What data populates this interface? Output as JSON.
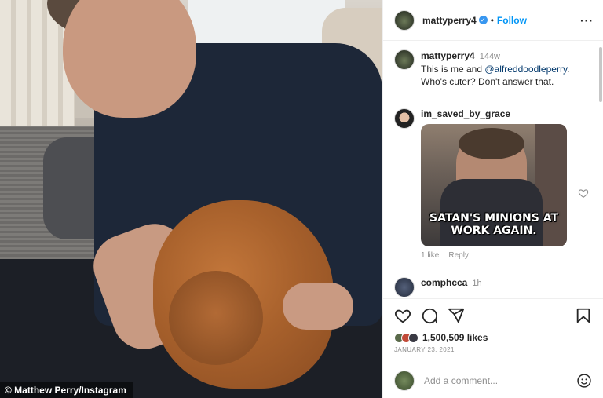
{
  "photo": {
    "credit": "© Matthew Perry/Instagram"
  },
  "post": {
    "username": "mattyperry4",
    "verified_icon": "verified-badge-icon",
    "follow_label": "Follow",
    "more_icon": "more-options-icon",
    "caption": {
      "username": "mattyperry4",
      "time": "144w",
      "text_before": "This is me and ",
      "mention": "@alfreddoodleperry",
      "text_after": ". Who's cuter? Don't answer that."
    },
    "comments": [
      {
        "username": "im_saved_by_grace",
        "gif_text": "SATAN'S MINIONS AT WORK AGAIN.",
        "likes": "1 like",
        "reply_label": "Reply"
      },
      {
        "username": "comphcca",
        "time": "1h"
      }
    ],
    "actions": {
      "icons": [
        "heart-icon",
        "comment-icon",
        "share-icon",
        "bookmark-icon"
      ]
    },
    "likes": "1,500,509 likes",
    "date": "JANUARY 23, 2021",
    "add_comment": {
      "placeholder": "Add a comment...",
      "emoji_icon": "emoji-icon"
    }
  },
  "colors": {
    "accent": "#0095f6",
    "text": "#262626",
    "muted": "#8e8e8e",
    "mention": "#00376b"
  }
}
